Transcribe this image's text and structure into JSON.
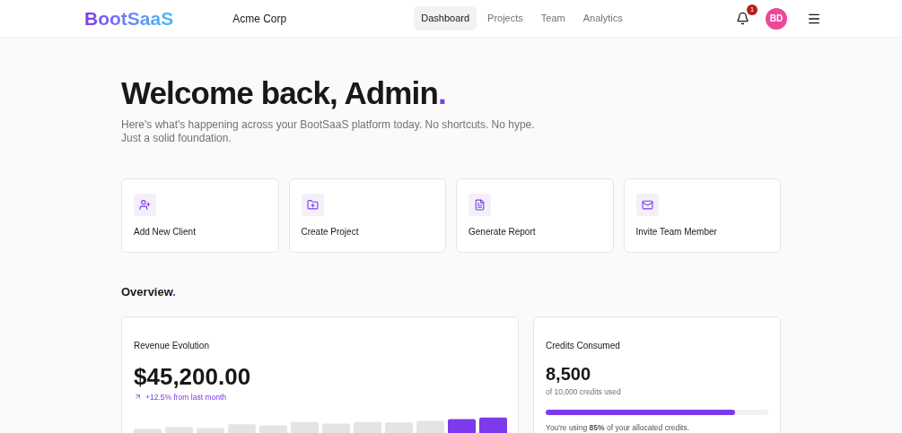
{
  "brand": "BootSaaS",
  "org": "Acme Corp",
  "nav": [
    {
      "label": "Dashboard",
      "selected": true
    },
    {
      "label": "Projects",
      "selected": false
    },
    {
      "label": "Team",
      "selected": false
    },
    {
      "label": "Analytics",
      "selected": false
    }
  ],
  "notifications": {
    "count": "1"
  },
  "avatar": {
    "initials": "BD"
  },
  "heading": {
    "text": "Welcome back, Admin",
    "accent": "."
  },
  "subtitle": "Here's what's happening across your BootSaaS platform today. No shortcuts. No hype. Just a solid foundation.",
  "actions": [
    {
      "kind": "user-plus",
      "label": "Add New Client"
    },
    {
      "kind": "folder-plus",
      "label": "Create Project"
    },
    {
      "kind": "file",
      "label": "Generate Report"
    },
    {
      "kind": "mail",
      "label": "Invite Team Member"
    }
  ],
  "overview": {
    "title": "Overview",
    "accent": "."
  },
  "revenue": {
    "title": "Revenue Evolution",
    "value": "$45,200.00",
    "change": "+12.5% from last month"
  },
  "credits": {
    "title": "Credits Consumed",
    "value": "8,500",
    "caption": "of 10,000 credits used",
    "level": 0.85,
    "note": "You're using **85%** of your allocated credits."
  }
}
